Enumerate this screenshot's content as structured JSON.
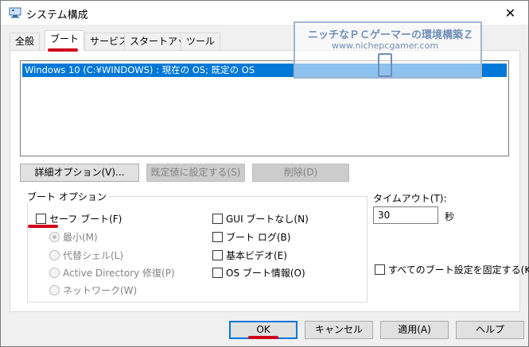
{
  "window": {
    "title": "システム構成",
    "close_glyph": "✕"
  },
  "tabs": [
    {
      "label": "全般"
    },
    {
      "label": "ブート"
    },
    {
      "label": "サービス"
    },
    {
      "label": "スタートアップ"
    },
    {
      "label": "ツール"
    }
  ],
  "boot_list": {
    "items": [
      "Windows 10 (C:¥WINDOWS) : 現在の OS; 既定の OS"
    ]
  },
  "action_buttons": {
    "advanced": "詳細オプション(V)...",
    "set_default": "既定値に設定する(S)",
    "delete": "削除(D)"
  },
  "boot_options": {
    "title": "ブート オプション",
    "safe_boot": "セーフ ブート(F)",
    "radios": [
      {
        "label": "最小(M)",
        "selected": true
      },
      {
        "label": "代替シェル(L)",
        "selected": false
      },
      {
        "label": "Active Directory 修復(P)",
        "selected": false
      },
      {
        "label": "ネットワーク(W)",
        "selected": false
      }
    ],
    "right_checks": [
      {
        "label": "GUI ブートなし(N)"
      },
      {
        "label": "ブート ログ(B)"
      },
      {
        "label": "基本ビデオ(E)"
      },
      {
        "label": "OS ブート情報(O)"
      }
    ]
  },
  "timeout": {
    "label": "タイムアウト(T):",
    "value": "30",
    "unit": "秒"
  },
  "permanent": {
    "label": "すべてのブート設定を固定する(K)"
  },
  "footer_buttons": {
    "ok": "OK",
    "cancel": "キャンセル",
    "apply": "適用(A)",
    "help": "ヘルプ"
  },
  "watermark": {
    "line1": "ニッチなＰＣゲーマーの環境構築Ｚ",
    "line2": "www.nichepcgamer.com"
  },
  "colors": {
    "selection": "#0078d7",
    "highlight_mark": "#d0021b"
  }
}
